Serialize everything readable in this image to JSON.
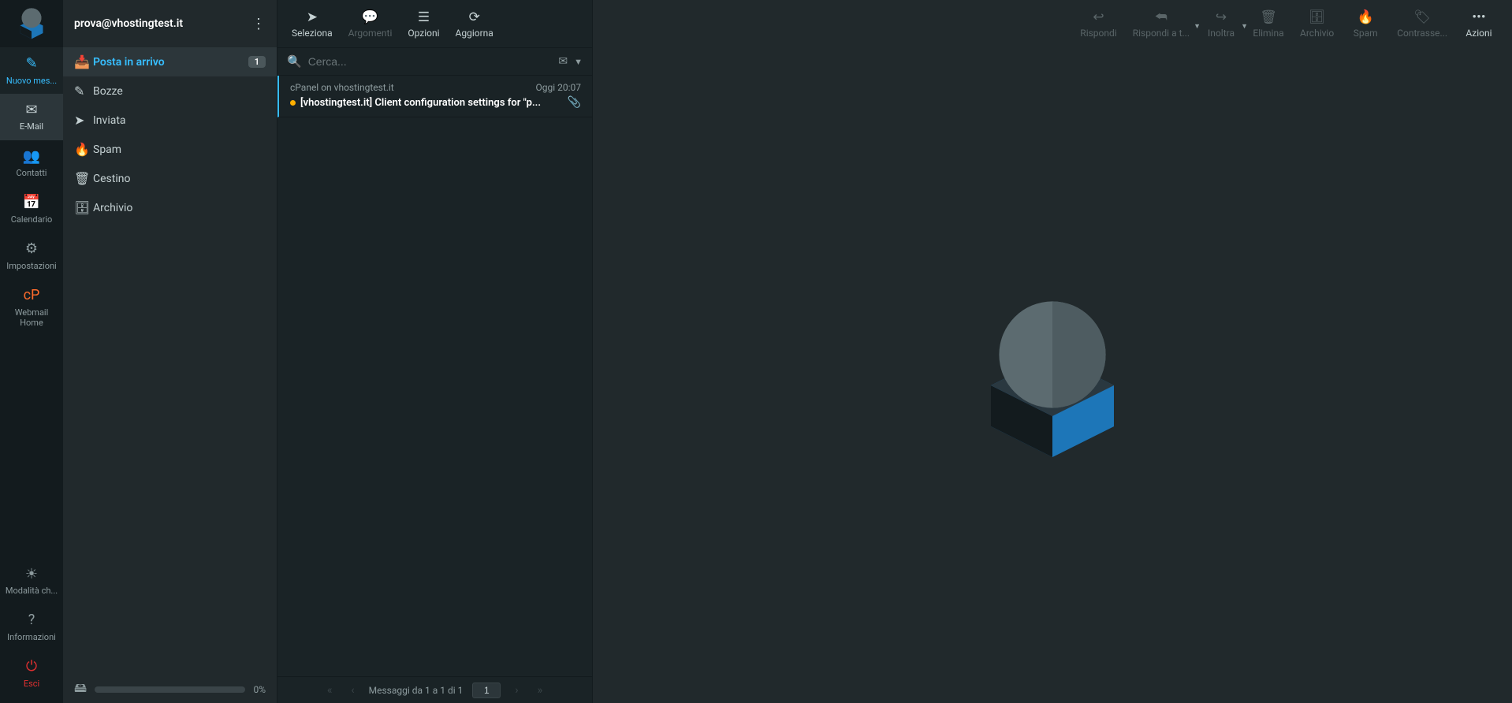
{
  "account": {
    "email": "prova@vhostingtest.it"
  },
  "nav": {
    "compose": "Nuovo mes...",
    "email": "E-Mail",
    "contacts": "Contatti",
    "calendar": "Calendario",
    "settings": "Impostazioni",
    "webmail_home_l1": "Webmail",
    "webmail_home_l2": "Home",
    "darkmode": "Modalità ch...",
    "about": "Informazioni",
    "logout": "Esci"
  },
  "folders": [
    {
      "key": "inbox",
      "label": "Posta in arrivo",
      "icon": "📥",
      "active": true,
      "badge": "1"
    },
    {
      "key": "drafts",
      "label": "Bozze",
      "icon": "✎"
    },
    {
      "key": "sent",
      "label": "Inviata",
      "icon": "➤"
    },
    {
      "key": "spam",
      "label": "Spam",
      "icon": "🔥"
    },
    {
      "key": "trash",
      "label": "Cestino",
      "icon": "🗑"
    },
    {
      "key": "archive",
      "label": "Archivio",
      "icon": "🗄"
    }
  ],
  "quota": {
    "percent": "0%"
  },
  "list_toolbar": {
    "select": "Seleziona",
    "threads": "Argomenti",
    "options": "Opzioni",
    "refresh": "Aggiorna"
  },
  "search": {
    "placeholder": "Cerca..."
  },
  "messages": [
    {
      "from": "cPanel on vhostingtest.it",
      "date": "Oggi 20:07",
      "subject": "[vhostingtest.it] Client configuration settings for \"p...",
      "unread": true,
      "attachment": true
    }
  ],
  "pager": {
    "info": "Messaggi da 1 a 1 di 1",
    "page": "1"
  },
  "preview_toolbar": {
    "reply": "Rispondi",
    "reply_all": "Rispondi a t...",
    "forward": "Inoltra",
    "delete": "Elimina",
    "archive": "Archivio",
    "spam": "Spam",
    "mark": "Contrasse...",
    "actions": "Azioni"
  }
}
